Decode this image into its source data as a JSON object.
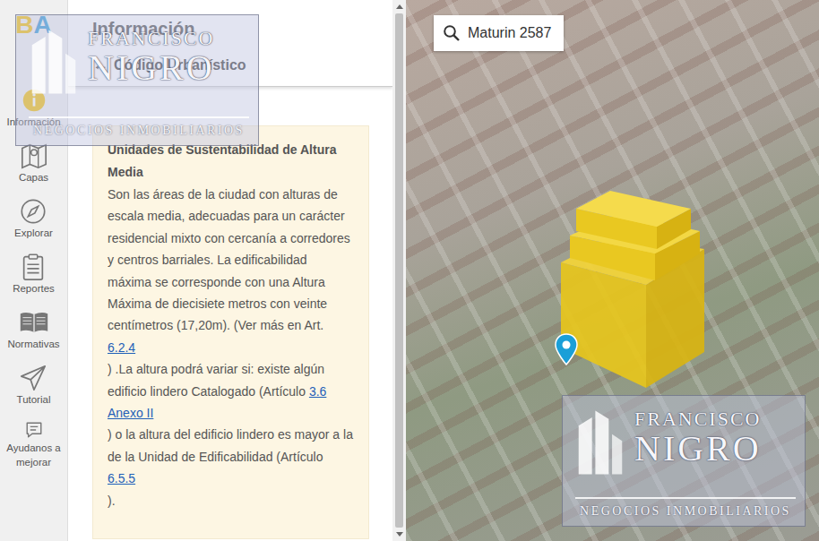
{
  "sidebar": {
    "logo": "BA",
    "items": [
      {
        "label": "Información",
        "icon": "info",
        "selected": true
      },
      {
        "label": "Capas",
        "icon": "layers",
        "selected": false
      },
      {
        "label": "Explorar",
        "icon": "compass",
        "selected": false
      },
      {
        "label": "Reportes",
        "icon": "report",
        "selected": false
      },
      {
        "label": "Normativas",
        "icon": "book",
        "selected": false
      },
      {
        "label": "Tutorial",
        "icon": "plane",
        "selected": false
      },
      {
        "label": "Ayudanos a mejorar",
        "icon": "chat",
        "selected": false
      }
    ]
  },
  "panel": {
    "title": "Información",
    "back": "←",
    "breadcrumb": "Código Urbanístico"
  },
  "card": {
    "title": "Unidades de Sustentabilidad de Altura Media",
    "segments": [
      {
        "kind": "text",
        "text": "Son las áreas de la ciudad con alturas de escala media, adecuadas para un carácter residencial mixto con cercanía a corredores y centros barriales. La edificabilidad máxima se corresponde con una Altura Máxima de diecisiete metros con veinte centímetros (17,20m). (Ver más en Art. "
      },
      {
        "kind": "link",
        "text": "6.2.4"
      },
      {
        "kind": "text",
        "text": "\n) .La altura podrá variar si: existe algún edificio lindero Catalogado (Artículo "
      },
      {
        "kind": "link",
        "text": "3.6 Anexo II"
      },
      {
        "kind": "text",
        "text": "\n) o la altura del edificio lindero es mayor a la de la Unidad de Edificabilidad (Artículo "
      },
      {
        "kind": "link",
        "text": "6.5.5"
      },
      {
        "kind": "text",
        "text": "\n)."
      }
    ]
  },
  "map": {
    "search": "Maturin 2587"
  },
  "watermarks": [
    {
      "line1": "FRANCISCO",
      "line2": "NIGRO",
      "line3": "NEGOCIOS INMOBILIARIOS"
    },
    {
      "line1": "FRANCISCO",
      "line2": "NIGRO",
      "line3": "NEGOCIOS INMOBILIARIOS"
    }
  ]
}
